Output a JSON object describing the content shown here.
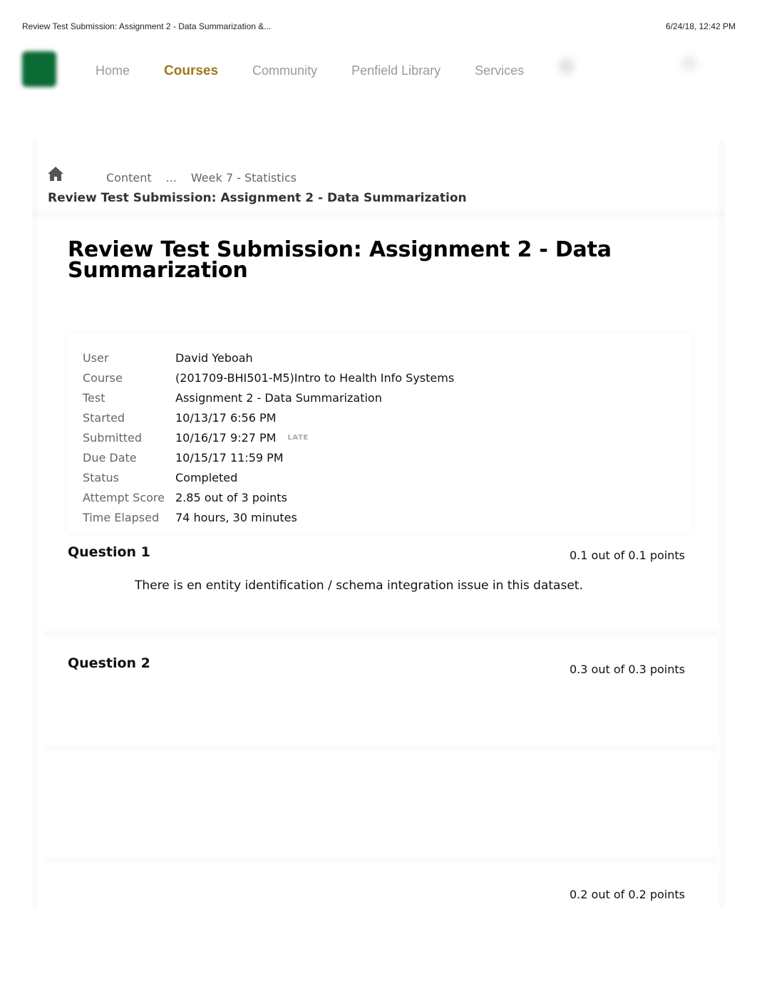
{
  "print_header": {
    "title": "Review Test Submission: Assignment 2 - Data Summarization &...",
    "datetime": "6/24/18, 12:42 PM"
  },
  "topnav": {
    "logo": "institution-logo",
    "items": [
      {
        "label": "Home",
        "active": false
      },
      {
        "label": "Courses",
        "active": true
      },
      {
        "label": "Community",
        "active": false
      },
      {
        "label": "Penfield Library",
        "active": false
      },
      {
        "label": "Services",
        "active": false
      }
    ],
    "active_color": "#9a7a1e",
    "inactive_color": "#9a9a9a"
  },
  "breadcrumb": {
    "home_icon": "home-icon",
    "items": [
      "Content",
      "...",
      "Week 7 - Statistics"
    ],
    "current": "Review Test Submission: Assignment 2 - Data Summarization"
  },
  "page": {
    "title": "Review Test Submission: Assignment 2 - Data Summarization"
  },
  "details": {
    "rows": [
      {
        "label": "User",
        "value": "David Yeboah"
      },
      {
        "label": "Course",
        "value": "(201709-BHI501-M5)Intro to Health Info Systems"
      },
      {
        "label": "Test",
        "value": "Assignment 2 - Data Summarization"
      },
      {
        "label": "Started",
        "value": "10/13/17 6:56 PM"
      },
      {
        "label": "Submitted",
        "value": "10/16/17 9:27 PM",
        "badge": "LATE"
      },
      {
        "label": "Due Date",
        "value": "10/15/17 11:59 PM"
      },
      {
        "label": "Status",
        "value": "Completed"
      },
      {
        "label": "Attempt Score",
        "value": "2.85 out of 3 points"
      },
      {
        "label": "Time Elapsed",
        "value": "74 hours, 30 minutes"
      }
    ]
  },
  "questions": [
    {
      "title": "Question 1",
      "points": "0.1 out of 0.1 points",
      "text": "There is en entity identification / schema integration issue in this dataset."
    },
    {
      "title": "Question 2",
      "points": "0.3 out of 0.3 points"
    },
    {
      "points": "0.2 out of 0.2 points"
    }
  ]
}
